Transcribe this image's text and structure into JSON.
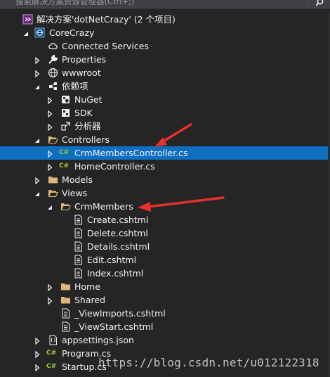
{
  "search": {
    "placeholder": "搜索解决方案资源管理器(Ctrl+;)"
  },
  "colors": {
    "background": "#252526",
    "selected": "#0e6fc1",
    "folder": "#dcb67a",
    "csharp": "#9acd32",
    "arrow": "#e8302b"
  },
  "tree": {
    "solution": "解决方案'dotNetCrazy' (2 个项目)",
    "project": "CoreCrazy",
    "connected_services": "Connected Services",
    "properties": "Properties",
    "wwwroot": "wwwroot",
    "dependencies": "依赖项",
    "nuget": "NuGet",
    "sdk": "SDK",
    "analyzers": "分析器",
    "controllers": "Controllers",
    "crm_controller": "CrmMembersController.cs",
    "home_controller": "HomeController.cs",
    "models": "Models",
    "views": "Views",
    "crm_members": "CrmMembers",
    "create": "Create.cshtml",
    "delete": "Delete.cshtml",
    "details": "Details.cshtml",
    "edit": "Edit.cshtml",
    "index": "Index.cshtml",
    "home": "Home",
    "shared": "Shared",
    "view_imports": "_ViewImports.cshtml",
    "view_start": "_ViewStart.cshtml",
    "appsettings": "appsettings.json",
    "program": "Program.cs",
    "startup": "Startup.cs"
  },
  "icons": {
    "csharp_glyph": "C#"
  },
  "watermark": "https://blog.csdn.net/u012122318"
}
